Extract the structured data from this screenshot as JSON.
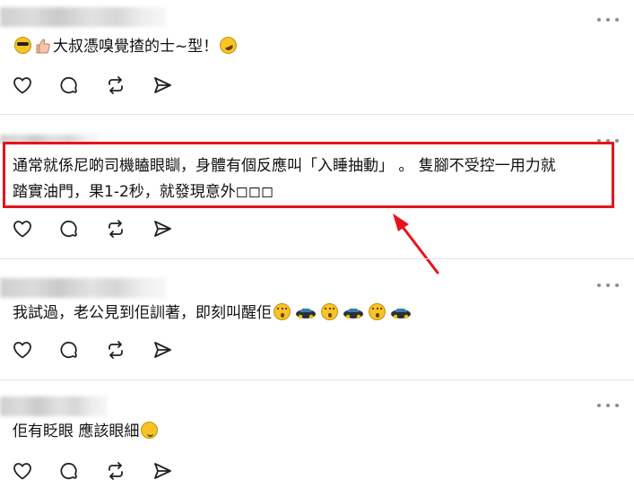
{
  "posts": [
    {
      "segments": [
        "",
        "大叔憑嗅覺揸的士~型！",
        ""
      ],
      "emoji_order": [
        "sunglasses-emoji",
        "thumbs-up-emoji",
        "text",
        "rofl-emoji"
      ]
    },
    {
      "line1": "通常就係尼啲司機瞌眼瞓，身體有個反應叫「入睡抽動」 。 隻腳不受控一用力就",
      "line2": "踏實油門，果1-2秒，就發現意外◻◻◻"
    },
    {
      "text": "我試過，老公見到佢訓著，即刻叫醒佢"
    },
    {
      "text": "佢有眨眼 應該眼細"
    }
  ],
  "action_icons": [
    "heart-icon",
    "comment-icon",
    "repost-icon",
    "share-icon"
  ],
  "colors": {
    "highlight": "#e5141c",
    "divider": "#e3e3e3",
    "icon": "#222222"
  }
}
